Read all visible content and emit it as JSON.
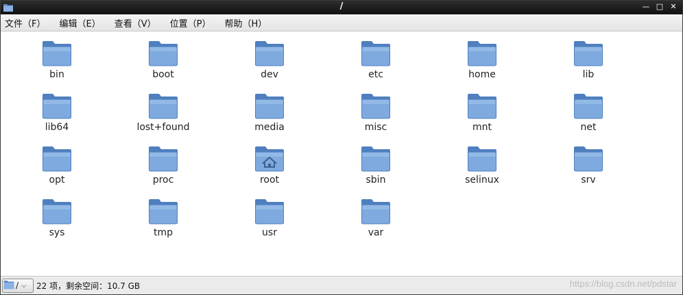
{
  "window": {
    "title": "/"
  },
  "menu": [
    {
      "id": "file",
      "label": "文件（F）"
    },
    {
      "id": "edit",
      "label": "编辑（E）"
    },
    {
      "id": "view",
      "label": "查看（V）"
    },
    {
      "id": "places",
      "label": "位置（P）"
    },
    {
      "id": "help",
      "label": "帮助（H）"
    }
  ],
  "files": [
    {
      "name": "bin",
      "icon": "folder-icon"
    },
    {
      "name": "boot",
      "icon": "folder-icon"
    },
    {
      "name": "dev",
      "icon": "folder-icon"
    },
    {
      "name": "etc",
      "icon": "folder-icon"
    },
    {
      "name": "home",
      "icon": "folder-icon"
    },
    {
      "name": "lib",
      "icon": "folder-icon"
    },
    {
      "name": "lib64",
      "icon": "folder-icon"
    },
    {
      "name": "lost+found",
      "icon": "folder-icon"
    },
    {
      "name": "media",
      "icon": "folder-icon"
    },
    {
      "name": "misc",
      "icon": "folder-icon"
    },
    {
      "name": "mnt",
      "icon": "folder-icon"
    },
    {
      "name": "net",
      "icon": "folder-icon"
    },
    {
      "name": "opt",
      "icon": "folder-icon"
    },
    {
      "name": "proc",
      "icon": "folder-icon"
    },
    {
      "name": "root",
      "icon": "home-folder-icon"
    },
    {
      "name": "sbin",
      "icon": "folder-icon"
    },
    {
      "name": "selinux",
      "icon": "folder-icon"
    },
    {
      "name": "srv",
      "icon": "folder-icon"
    },
    {
      "name": "sys",
      "icon": "folder-icon"
    },
    {
      "name": "tmp",
      "icon": "folder-icon"
    },
    {
      "name": "usr",
      "icon": "folder-icon"
    },
    {
      "name": "var",
      "icon": "folder-icon"
    }
  ],
  "statusbar": {
    "location": "/",
    "info": "22 项，剩余空间：10.7 GB"
  },
  "watermark": "https://blog.csdn.net/pdstar",
  "colors": {
    "folder_front": "#7aa6dc",
    "folder_back": "#5b88c4",
    "titlebar": "#1e1e1e"
  }
}
